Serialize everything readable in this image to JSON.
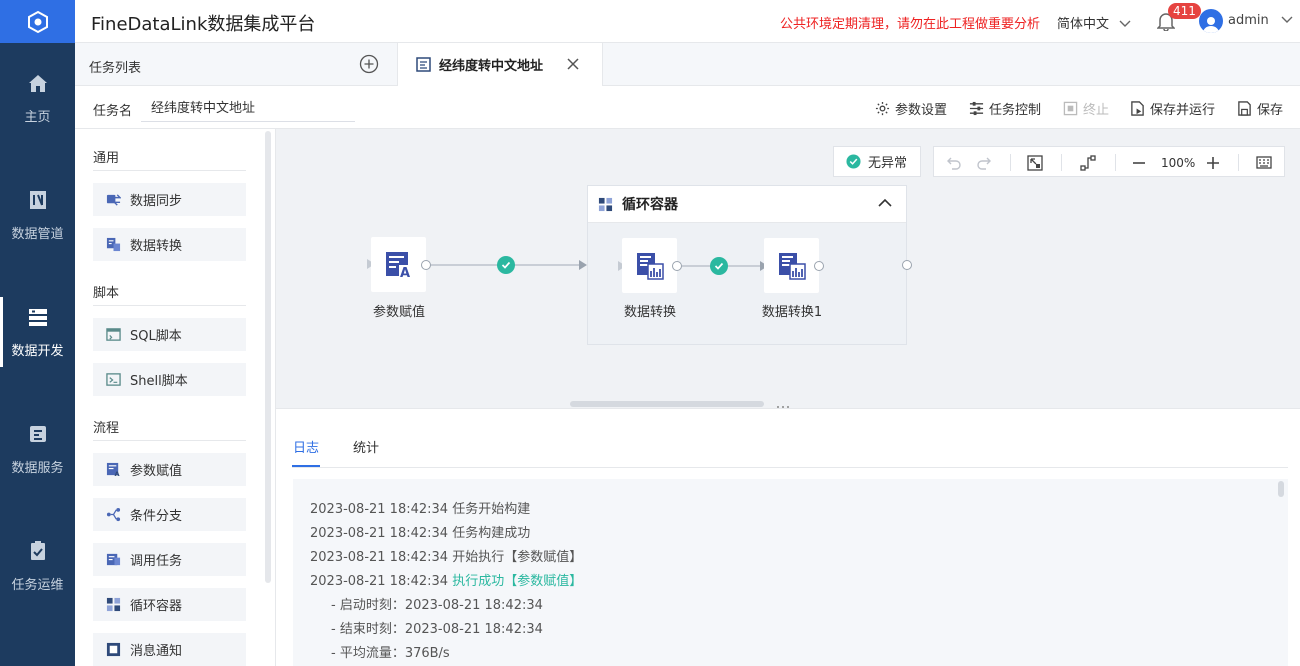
{
  "app": {
    "title": "FineDataLink数据集成平台",
    "notice": "公共环境定期清理，请勿在此工程做重要分析",
    "language": "简体中文",
    "notification_count": "411",
    "username": "admin"
  },
  "nav": [
    {
      "label": "主页",
      "icon": "home-icon"
    },
    {
      "label": "数据管道",
      "icon": "pipeline-icon"
    },
    {
      "label": "数据开发",
      "icon": "dev-icon",
      "active": true
    },
    {
      "label": "数据服务",
      "icon": "service-icon"
    },
    {
      "label": "任务运维",
      "icon": "ops-icon"
    }
  ],
  "tabs": {
    "list_label": "任务列表",
    "active_tab": "经纬度转中文地址"
  },
  "task": {
    "name_label": "任务名",
    "name_value": "经纬度转中文地址",
    "actions": {
      "params": "参数设置",
      "control": "任务控制",
      "stop": "终止",
      "save_run": "保存并运行",
      "save": "保存"
    }
  },
  "palette": {
    "categories": [
      {
        "title": "通用",
        "items": [
          "数据同步",
          "数据转换"
        ]
      },
      {
        "title": "脚本",
        "items": [
          "SQL脚本",
          "Shell脚本"
        ]
      },
      {
        "title": "流程",
        "items": [
          "参数赋值",
          "条件分支",
          "调用任务",
          "循环容器",
          "消息通知"
        ]
      }
    ]
  },
  "canvas": {
    "status": "无异常",
    "zoom": "100%",
    "nodes": [
      "参数赋值",
      "数据转换",
      "数据转换1"
    ],
    "container_title": "循环容器"
  },
  "log": {
    "tabs": [
      "日志",
      "统计"
    ],
    "lines": [
      {
        "time": "2023-08-21 18:42:34",
        "msg": "任务开始构建"
      },
      {
        "time": "2023-08-21 18:42:34",
        "msg": "任务构建成功"
      },
      {
        "time": "2023-08-21 18:42:34",
        "msg": "开始执行【参数赋值】"
      },
      {
        "time": "2023-08-21 18:42:34",
        "msg": "执行成功【参数赋值】"
      },
      {
        "text": "- 启动时刻：2023-08-21 18:42:34"
      },
      {
        "text": "- 结束时刻：2023-08-21 18:42:34"
      },
      {
        "text": "- 平均流量：376B/s"
      }
    ]
  },
  "colors": {
    "nav_bg": "#1d3b5f",
    "accent": "#2f6fe4",
    "success": "#2bb8a0",
    "notice": "#ee2222"
  }
}
